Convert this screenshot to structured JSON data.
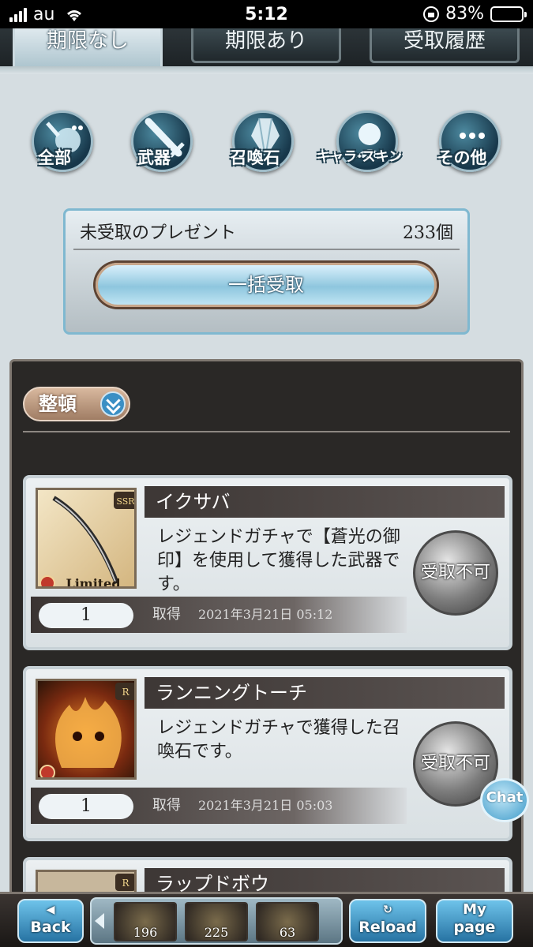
{
  "status_bar": {
    "carrier": "au",
    "time": "5:12",
    "battery": "83%",
    "battery_level": 0.83
  },
  "tabs": [
    {
      "label": "期限なし",
      "active": true
    },
    {
      "label": "期限あり",
      "active": false
    },
    {
      "label": "受取履歴",
      "active": false
    }
  ],
  "categories": [
    {
      "label": "全部",
      "icon": "all-items-icon"
    },
    {
      "label": "武器",
      "icon": "sword-icon"
    },
    {
      "label": "召喚石",
      "icon": "crystal-icon"
    },
    {
      "label": "キャラ·スキン",
      "icon": "character-icon"
    },
    {
      "label": "その他",
      "icon": "more-icon"
    }
  ],
  "unclaimed": {
    "title": "未受取のプレゼント",
    "count": "233個",
    "bulk_label": "一括受取"
  },
  "sort_label": "整頓",
  "items": [
    {
      "name": "イクサバ",
      "description": "レジェンドガチャで【蒼光の御印】を使用して獲得した武器です。",
      "claim": "受取不可",
      "qty": "1",
      "acquired_label": "取得",
      "date": "2021年3月21日 05:12",
      "rarity": "SSR",
      "limited": "Limited"
    },
    {
      "name": "ランニングトーチ",
      "description": "レジェンドガチャで獲得した召喚石です。",
      "claim": "受取不可",
      "qty": "1",
      "acquired_label": "取得",
      "date": "2021年3月21日 05:03",
      "rarity": "R"
    },
    {
      "name": "ラップドボウ",
      "rarity": "R"
    }
  ],
  "chat_label": "Chat",
  "bottom_nav": {
    "back": {
      "top": "◀",
      "main": "Back"
    },
    "reload": {
      "top": "↻",
      "main": "Reload"
    },
    "mypage": {
      "top": "My",
      "main": "page"
    },
    "slots": [
      "196",
      "225",
      "63"
    ]
  },
  "colors": {
    "accent": "#3a8fc4",
    "panel": "#2a2826",
    "tab_active": "#cbd9df"
  }
}
